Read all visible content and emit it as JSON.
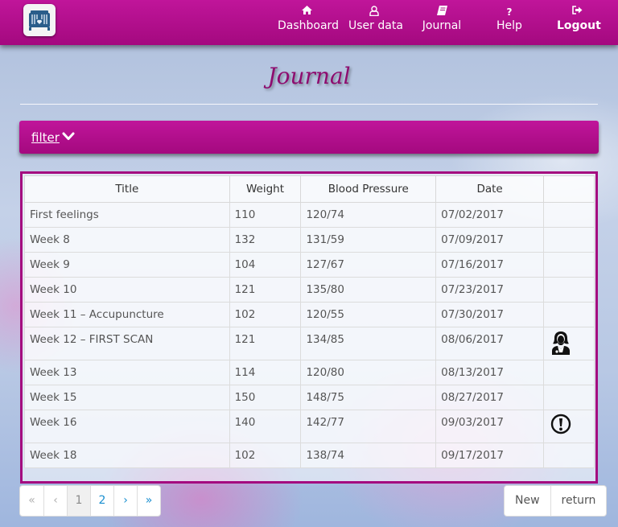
{
  "nav": {
    "items": [
      {
        "label": "Dashboard",
        "icon": "home-icon"
      },
      {
        "label": "User data",
        "icon": "user-icon"
      },
      {
        "label": "Journal",
        "icon": "book-icon"
      },
      {
        "label": "Help",
        "icon": "question-icon"
      },
      {
        "label": "Logout",
        "icon": "sign-out-icon"
      }
    ],
    "help_glyph": "?"
  },
  "page": {
    "title": "Journal"
  },
  "filter": {
    "label": "filter"
  },
  "table": {
    "columns": [
      "Title",
      "Weight",
      "Blood Pressure",
      "Date",
      ""
    ],
    "rows": [
      {
        "title": "First feelings",
        "weight": "110",
        "bp": "120/74",
        "date": "07/02/2017",
        "icon": ""
      },
      {
        "title": "Week 8",
        "weight": "132",
        "bp": "131/59",
        "date": "07/09/2017",
        "icon": ""
      },
      {
        "title": "Week 9",
        "weight": "104",
        "bp": "127/67",
        "date": "07/16/2017",
        "icon": ""
      },
      {
        "title": "Week 10",
        "weight": "121",
        "bp": "135/80",
        "date": "07/23/2017",
        "icon": ""
      },
      {
        "title": "Week 11 – Accupuncture",
        "weight": "102",
        "bp": "120/55",
        "date": "07/30/2017",
        "icon": ""
      },
      {
        "title": "Week 12 – FIRST SCAN",
        "weight": "121",
        "bp": "134/85",
        "date": "08/06/2017",
        "icon": "doctor-icon"
      },
      {
        "title": "Week 13",
        "weight": "114",
        "bp": "120/80",
        "date": "08/13/2017",
        "icon": ""
      },
      {
        "title": "Week 15",
        "weight": "150",
        "bp": "148/75",
        "date": "08/27/2017",
        "icon": ""
      },
      {
        "title": "Week 16",
        "weight": "140",
        "bp": "142/77",
        "date": "09/03/2017",
        "icon": "exclamation-circle-icon"
      },
      {
        "title": "Week 18",
        "weight": "102",
        "bp": "138/74",
        "date": "09/17/2017",
        "icon": ""
      }
    ]
  },
  "pagination": {
    "first": "«",
    "prev": "‹",
    "pages": [
      "1",
      "2"
    ],
    "current": "1",
    "next": "›",
    "last": "»"
  },
  "actions": {
    "new_label": "New",
    "return_label": "return"
  },
  "colors": {
    "brand": "#a4097f",
    "link": "#1a8fd0"
  }
}
